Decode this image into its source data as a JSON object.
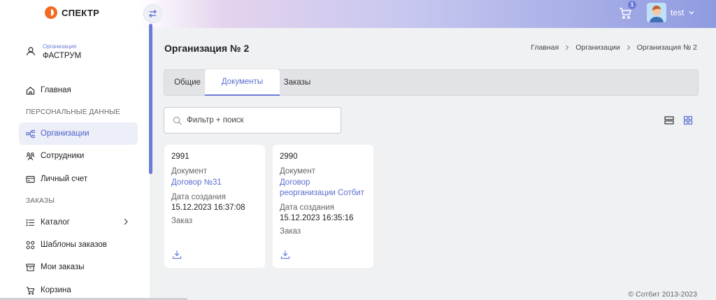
{
  "header": {
    "logo_text": "СПЕКТР",
    "cart_count": "1",
    "user_name": "test"
  },
  "sidebar": {
    "org_caption": "Организация",
    "org_name": "ФАСТРУМ",
    "items": [
      {
        "label": "Главная"
      },
      {
        "label": "Организации"
      },
      {
        "label": "Сотрудники"
      },
      {
        "label": "Личный счет"
      },
      {
        "label": "Каталог"
      },
      {
        "label": "Шаблоны заказов"
      },
      {
        "label": "Мои заказы"
      },
      {
        "label": "Корзина"
      }
    ],
    "sections": [
      "ПЕРСОНАЛЬНЫЕ ДАННЫЕ",
      "ЗАКАЗЫ"
    ]
  },
  "page": {
    "title": "Организация № 2",
    "breadcrumb": [
      "Главная",
      "Организации",
      "Организация № 2"
    ],
    "tabs": [
      "Общие",
      "Документы",
      "Заказы"
    ],
    "search_placeholder": "Фильтр + поиск"
  },
  "cards": [
    {
      "number": "2991",
      "doc_label": "Документ",
      "doc_link": "Договор №31",
      "date_label": "Дата создания",
      "date_value": "15.12.2023 16:37:08",
      "order_label": "Заказ"
    },
    {
      "number": "2990",
      "doc_label": "Документ",
      "doc_link": "Договор реорганизации Сотбит",
      "date_label": "Дата создания",
      "date_value": "15.12.2023 16:35:16",
      "order_label": "Заказ"
    }
  ],
  "footer": {
    "copyright": "© Сотбит 2013-2023"
  },
  "colors": {
    "accent": "#6b7cd6",
    "logo": "#f26b21"
  }
}
